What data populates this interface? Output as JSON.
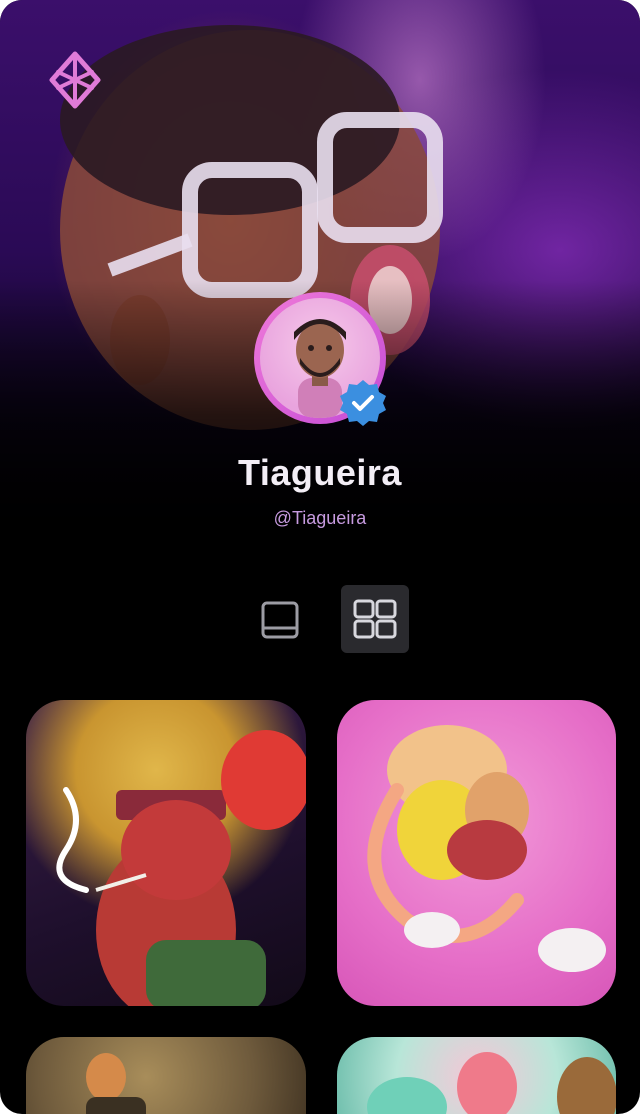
{
  "profile": {
    "name": "Tiagueira",
    "handle": "@Tiagueira",
    "verified": true
  },
  "icons": {
    "logo": "logo-icon",
    "verified": "verified-check-icon",
    "single_view": "single-view-icon",
    "grid_view": "grid-view-icon"
  },
  "view_toggle": {
    "active": "grid"
  },
  "gallery": [
    {
      "subject": "3D character with red mask"
    },
    {
      "subject": "3D burger character walking"
    },
    {
      "subject": "3D artwork"
    },
    {
      "subject": "3D artwork"
    }
  ],
  "colors": {
    "accent": "#e07bd8",
    "verified_blue": "#3b8fe0",
    "handle": "#c79be0",
    "background": "#000000"
  }
}
